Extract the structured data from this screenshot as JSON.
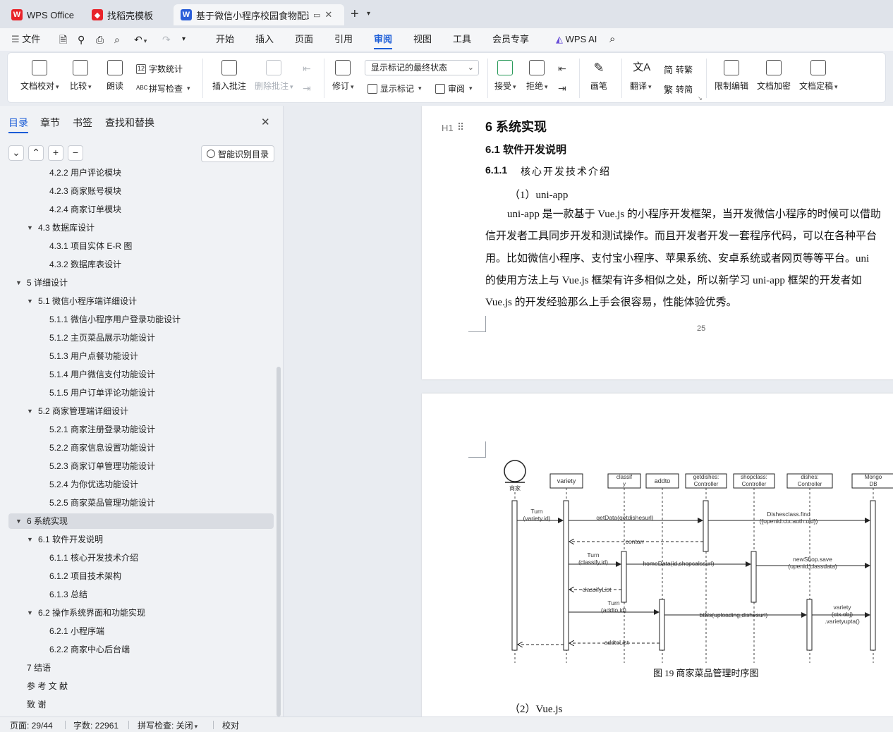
{
  "tabs": [
    {
      "label": "WPS Office",
      "icon": "wps-logo-icon",
      "color": "#e8242a"
    },
    {
      "label": "找稻壳模板",
      "icon": "docer-logo-icon",
      "color": "#e8242a"
    },
    {
      "label": "基于微信小程序校园食物配送",
      "icon": "word-logo-icon",
      "color": "#2b5fd9",
      "active": true
    }
  ],
  "menu": {
    "file": "文件",
    "items": [
      "开始",
      "插入",
      "页面",
      "引用",
      "审阅",
      "视图",
      "工具",
      "会员专享"
    ],
    "active": "审阅",
    "ai": "WPS AI"
  },
  "ribbon": {
    "doc_check": "文档校对",
    "compare": "比较",
    "read_aloud": "朗读",
    "word_count": "字数统计",
    "spell_check": "拼写检查",
    "insert_comment": "插入批注",
    "delete_comment": "删除批注",
    "revise": "修订",
    "markup_state": "显示标记的最终状态",
    "show_markup": "显示标记",
    "review": "审阅",
    "accept": "接受",
    "reject": "拒绝",
    "pen": "画笔",
    "translate": "翻译",
    "to_traditional": "转繁",
    "to_simplified": "转简",
    "restrict_edit": "限制编辑",
    "encrypt": "文档加密",
    "finalize": "文档定稿"
  },
  "nav": {
    "tabs": [
      "目录",
      "章节",
      "书签",
      "查找和替换"
    ],
    "ai_button": "智能识别目录",
    "toc": [
      {
        "text": "4.2.2   用户评论模块",
        "level": 3
      },
      {
        "text": "4.2.3   商家账号模块",
        "level": 3
      },
      {
        "text": "4.2.4   商家订单模块",
        "level": 3
      },
      {
        "text": "4.3    数据库设计",
        "level": 2,
        "expanded": true
      },
      {
        "text": "4.3.1   项目实体 E-R 图",
        "level": 3
      },
      {
        "text": "4.3.2   数据库表设计",
        "level": 3
      },
      {
        "text": "5    详细设计",
        "level": 1,
        "expanded": true
      },
      {
        "text": "5.1    微信小程序端详细设计",
        "level": 2,
        "expanded": true
      },
      {
        "text": "5.1.1  微信小程序用户登录功能设计",
        "level": 3
      },
      {
        "text": "5.1.2  主页菜品展示功能设计",
        "level": 3
      },
      {
        "text": "5.1.3  用户点餐功能设计",
        "level": 3
      },
      {
        "text": "5.1.4  用户微信支付功能设计",
        "level": 3
      },
      {
        "text": "5.1.5  用户订单评论功能设计",
        "level": 3
      },
      {
        "text": "5.2    商家管理端详细设计",
        "level": 2,
        "expanded": true
      },
      {
        "text": "5.2.1  商家注册登录功能设计",
        "level": 3
      },
      {
        "text": "5.2.2  商家信息设置功能设计",
        "level": 3
      },
      {
        "text": "5.2.3  商家订单管理功能设计",
        "level": 3
      },
      {
        "text": "5.2.4  为你优选功能设计",
        "level": 3
      },
      {
        "text": "5.2.5  商家菜品管理功能设计",
        "level": 3
      },
      {
        "text": "6    系统实现",
        "level": 1,
        "expanded": true,
        "selected": true
      },
      {
        "text": "6.1    软件开发说明",
        "level": 2,
        "expanded": true
      },
      {
        "text": "6.1.1    核心开发技术介绍",
        "level": 3
      },
      {
        "text": "6.1.2    项目技术架构",
        "level": 3
      },
      {
        "text": "6.1.3    总结",
        "level": 3
      },
      {
        "text": "6.2    操作系统界面和功能实现",
        "level": 2,
        "expanded": true
      },
      {
        "text": "6.2.1    小程序端",
        "level": 3
      },
      {
        "text": "6.2.2    商家中心后台端",
        "level": 3
      },
      {
        "text": "7    结语",
        "level": 1
      },
      {
        "text": "参    考    文    献",
        "level": 1
      },
      {
        "text": "致             谢",
        "level": 1
      }
    ]
  },
  "doc": {
    "h1": "6    系统实现",
    "h2": "6.1    软件开发说明",
    "h3_num": "6.1.1",
    "h3_text": "核心开发技术介绍",
    "item1": "（1）uni-app",
    "lines": [
      "uni-app 是一款基于 Vue.js 的小程序开发框架，当开发微信小程序的时候可以借助",
      "信开发者工具同步开发和测试操作。而且开发者开发一套程序代码，可以在各种平台",
      "用。比如微信小程序、支付宝小程序、苹果系统、安卓系统或者网页等等平台。uni",
      "的使用方法上与 Vue.js 框架有许多相似之处，所以新学习 uni-app 框架的开发者如",
      "Vue.js 的开发经验那么上手会很容易，性能体验优秀。"
    ],
    "page_number": "25",
    "heading_marker": "H1",
    "figure_caption": "图 19  商家菜品管理时序图",
    "item2": "（2）Vue.js",
    "diagram": {
      "actor": "商家",
      "lifelines": [
        "variety",
        "classif\ny",
        "addto",
        "getdishes:\nController",
        "shopclass:\nController",
        "dishes:\nController",
        "Mongo\nDB"
      ],
      "messages": [
        "Turn\n(variety,id)",
        "getData(getdishesurl)",
        "Dishesclass.find\n({openid:ctx.auth.uid})",
        "contarr",
        "Turn\n(classify,id)",
        "homeData(id,shopcalssurl)",
        "newShop.save\n(openid,classdata)",
        "classifyList",
        "Turn\n(addto,id)",
        "btNs(uploading,dishesurl)",
        "variety\n(ctx.obj)\n.varietyupta()",
        "addtoList"
      ]
    }
  },
  "status": {
    "page": "页面: 29/44",
    "words": "字数: 22961",
    "spell": "拼写检查: 关闭",
    "proof": "校对"
  }
}
